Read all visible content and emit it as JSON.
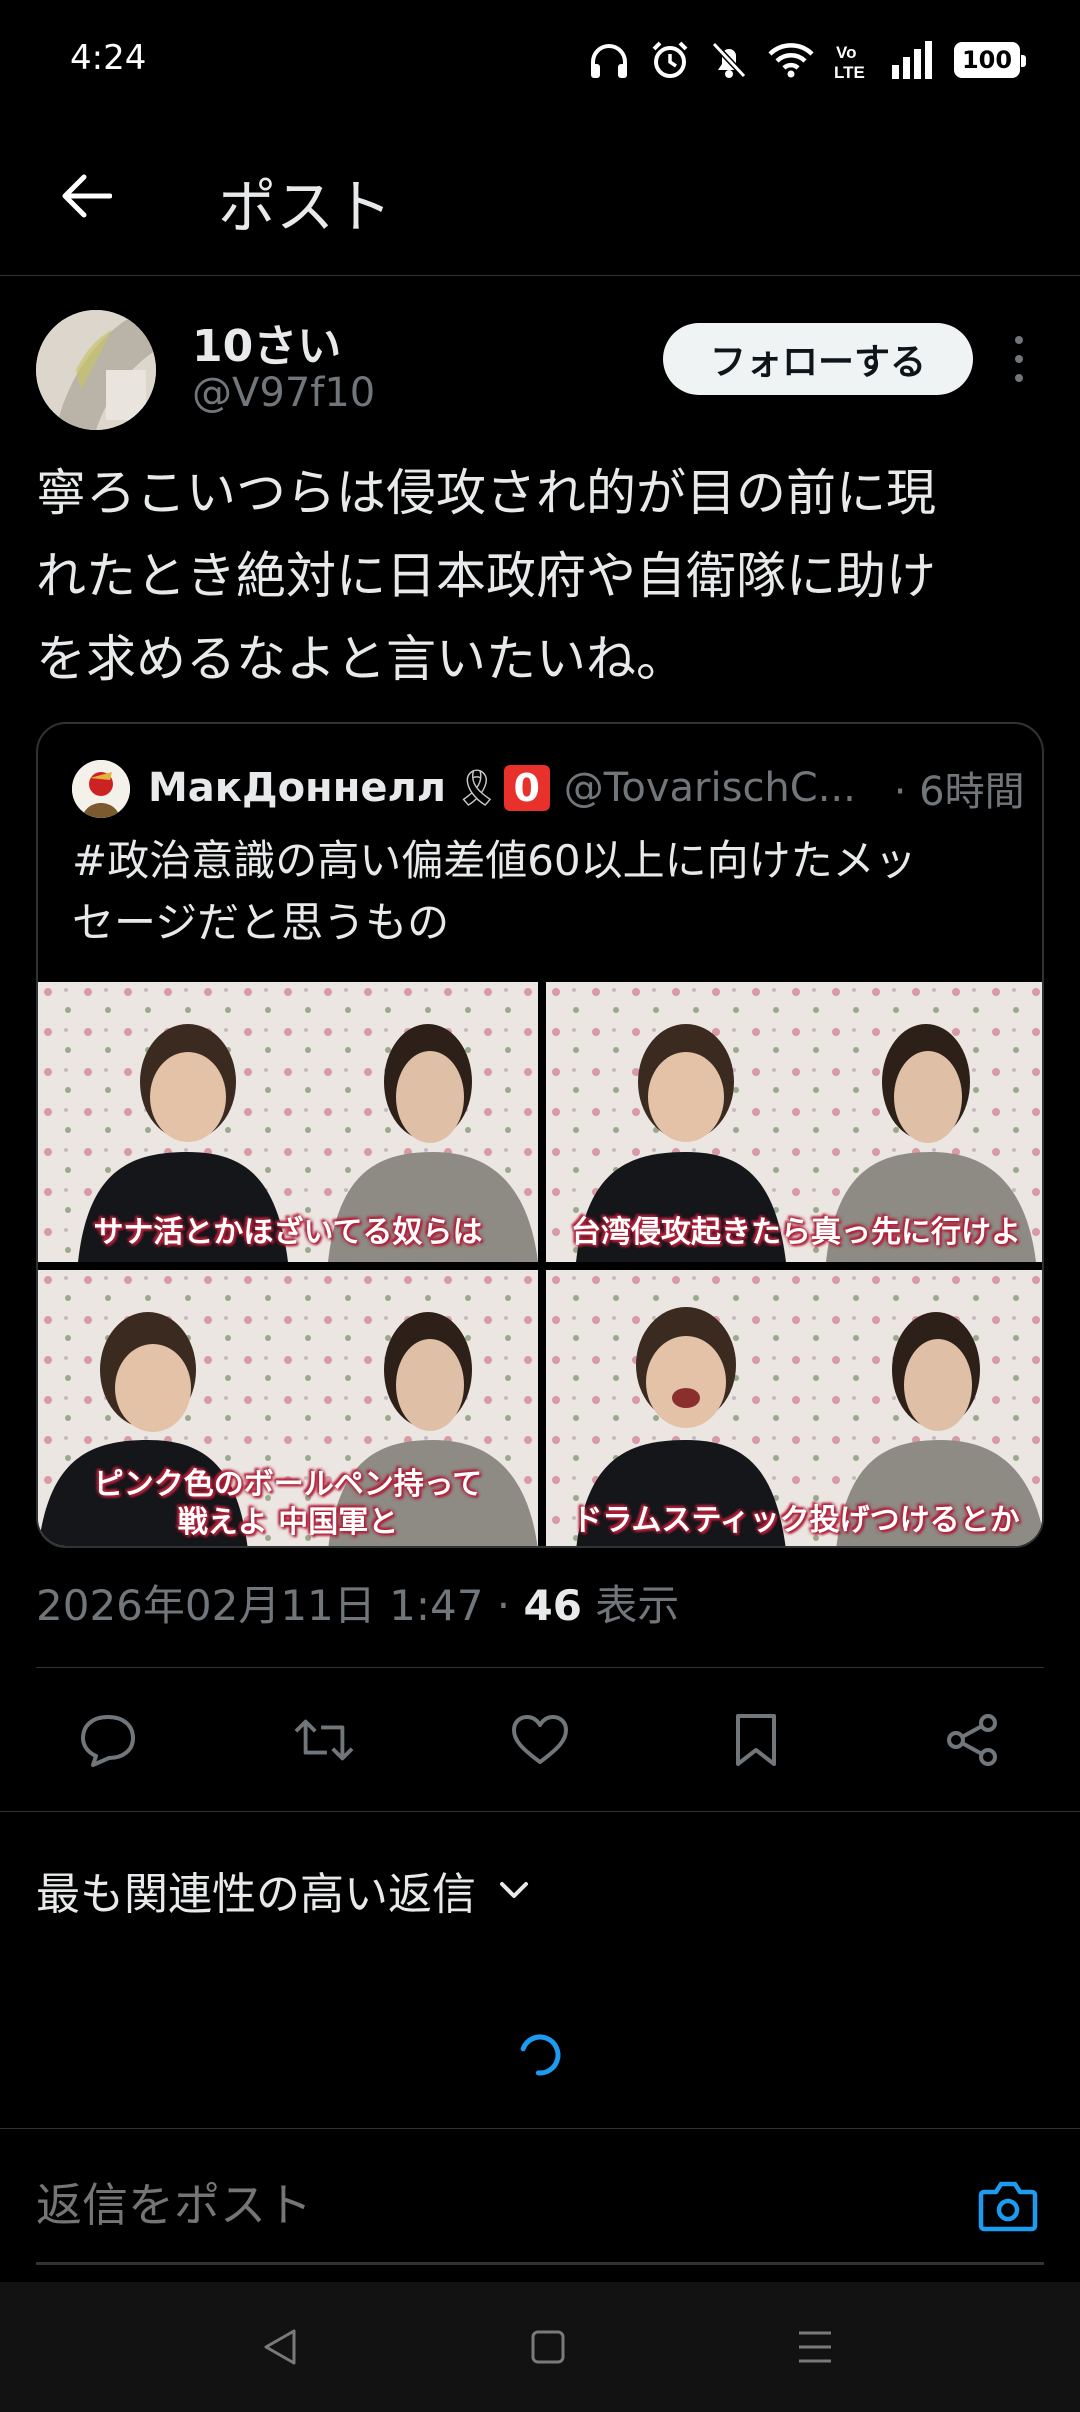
{
  "status_bar": {
    "time": "4:24",
    "battery": "100"
  },
  "header": {
    "title": "ポスト"
  },
  "author": {
    "name": "10さい",
    "handle": "@V97f10",
    "follow_label": "フォローする"
  },
  "post": {
    "lines": [
      "寧ろこいつらは侵攻され的が目の前に現",
      "れたとき絶対に日本政府や自衛隊に助け",
      "を求めるなよと言いたいね。"
    ]
  },
  "quote": {
    "name": "МакДоннелл",
    "handle": "@TovarischC...",
    "time": "· 6時間",
    "text_lines": [
      "#政治意識の高い偏差値60以上に向けたメッ",
      "セージだと思うもの"
    ],
    "images": [
      {
        "caption_lines": [
          "サナ活とかほざいてる奴らは"
        ]
      },
      {
        "caption_lines": [
          "台湾侵攻起きたら真っ先に行けよ"
        ]
      },
      {
        "caption_lines": [
          "ピンク色のボールペン持って",
          "戦えよ 中国軍と"
        ]
      },
      {
        "caption_lines": [
          "ドラムスティック投げつけるとか"
        ]
      }
    ]
  },
  "meta": {
    "date": "2026年02月11日 1:47 · ",
    "views": "46",
    "views_label": " 表示"
  },
  "replies": {
    "sort_label": "最も関連性の高い返信"
  },
  "reply_box": {
    "placeholder": "返信をポスト"
  },
  "colors": {
    "accent": "#1d9bf0",
    "muted": "#71767b",
    "border": "#2f3336"
  }
}
